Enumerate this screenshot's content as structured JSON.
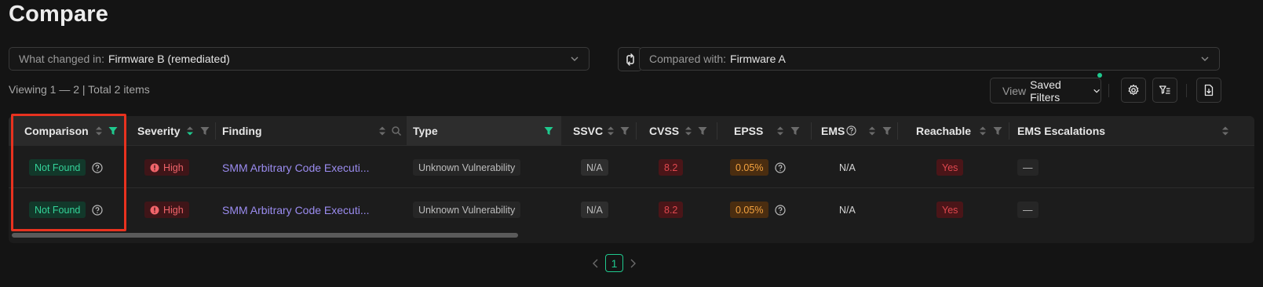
{
  "page": {
    "title": "Compare"
  },
  "what_changed": {
    "label": "What changed in:",
    "value": "Firmware B (remediated)"
  },
  "compared_with": {
    "label": "Compared with:",
    "value": "Firmware A"
  },
  "summary": {
    "text": "Viewing 1 — 2 | Total 2 items"
  },
  "view_filters": {
    "label": "View",
    "value": "Saved Filters"
  },
  "columns": [
    {
      "label": "Comparison"
    },
    {
      "label": "Severity"
    },
    {
      "label": "Finding"
    },
    {
      "label": "Type"
    },
    {
      "label": "SSVC"
    },
    {
      "label": "CVSS"
    },
    {
      "label": "EPSS"
    },
    {
      "label": "EMS"
    },
    {
      "label": "Reachable"
    },
    {
      "label": "EMS Escalations"
    }
  ],
  "rows": [
    {
      "comparison": "Not Found",
      "severity": "High",
      "finding": "SMM Arbitrary Code Executi...",
      "type": "Unknown Vulnerability",
      "ssvc": "N/A",
      "cvss": "8.2",
      "epss": "0.05%",
      "ems": "N/A",
      "reachable": "Yes",
      "ems_escalations": "—"
    },
    {
      "comparison": "Not Found",
      "severity": "High",
      "finding": "SMM Arbitrary Code Executi...",
      "type": "Unknown Vulnerability",
      "ssvc": "N/A",
      "cvss": "8.2",
      "epss": "0.05%",
      "ems": "N/A",
      "reachable": "Yes",
      "ems_escalations": "—"
    }
  ],
  "pagination": {
    "current_page": "1"
  },
  "colors": {
    "accent": "#1fc98e",
    "severity_high": "#f0646a",
    "highlight_box": "#e8321f",
    "link": "#9b8cf0",
    "epss": "#f4a340"
  },
  "icons": {
    "swap": "swap-icon",
    "chevron": "chevron-down-icon",
    "settings": "gear-icon",
    "column_filter": "column-filter-icon",
    "export": "export-file-icon",
    "sort": "sort-icon",
    "filter": "filter-icon",
    "search": "search-icon",
    "help": "help-circle-icon",
    "severity": "alert-circle-icon"
  }
}
